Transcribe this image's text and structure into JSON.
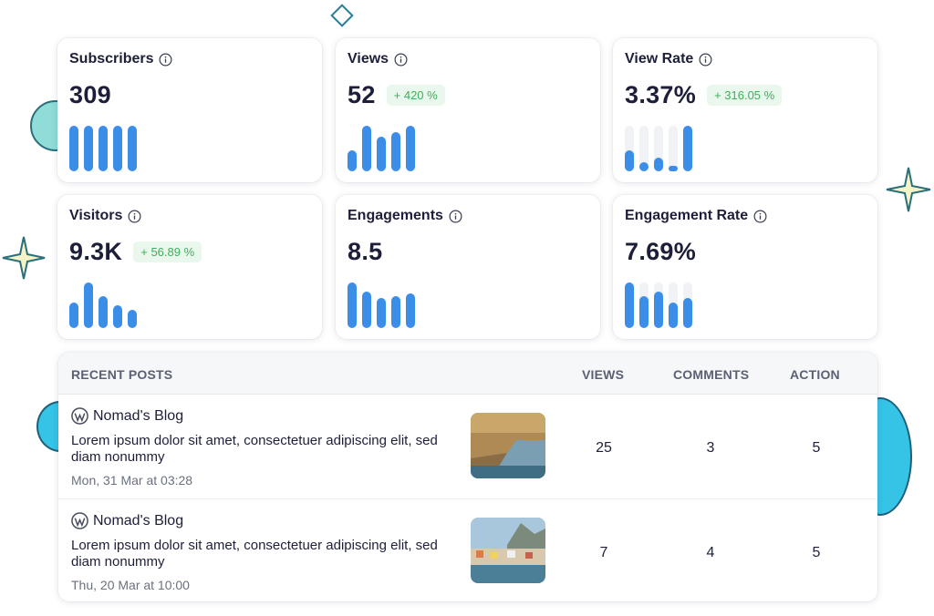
{
  "colors": {
    "bar": "#3b8ee8",
    "track": "#f1f2f5",
    "badge_bg": "#eaf7ec",
    "badge_text": "#3fae5a"
  },
  "cards": [
    {
      "title": "Subscribers",
      "value": "309",
      "badge": "",
      "bars": [
        1,
        1,
        1,
        1,
        1
      ],
      "tracks": false
    },
    {
      "title": "Views",
      "value": "52",
      "badge": "+ 420 %",
      "bars": [
        0.45,
        1,
        0.75,
        0.85,
        1
      ],
      "tracks": false
    },
    {
      "title": "View Rate",
      "value": "3.37%",
      "badge": "+ 316.05 %",
      "bars": [
        0.45,
        0.2,
        0.3,
        0.1,
        1
      ],
      "tracks": true
    },
    {
      "title": "Visitors",
      "value": "9.3K",
      "badge": "+ 56.89 %",
      "bars": [
        0.55,
        1,
        0.7,
        0.5,
        0.4
      ],
      "tracks": false
    },
    {
      "title": "Engagements",
      "value": "8.5",
      "badge": "",
      "bars": [
        1,
        0.8,
        0.65,
        0.7,
        0.75
      ],
      "tracks": false
    },
    {
      "title": "Engagement Rate",
      "value": "7.69%",
      "badge": "",
      "bars": [
        1,
        0.7,
        0.8,
        0.55,
        0.65
      ],
      "tracks": true
    }
  ],
  "table": {
    "headers": {
      "posts": "RECENT POSTS",
      "views": "VIEWS",
      "comments": "COMMENTS",
      "action": "ACTION"
    },
    "rows": [
      {
        "blog": "Nomad's Blog",
        "text": "Lorem ipsum dolor sit amet, consectetuer adipiscing elit, sed diam nonummy",
        "date": "Mon, 31 Mar at 03:28",
        "views": "25",
        "comments": "3",
        "action": "5"
      },
      {
        "blog": "Nomad's Blog",
        "text": "Lorem ipsum dolor sit amet, consectetuer adipiscing elit, sed diam nonummy",
        "date": "Thu, 20 Mar at 10:00",
        "views": "7",
        "comments": "4",
        "action": "5"
      }
    ]
  }
}
